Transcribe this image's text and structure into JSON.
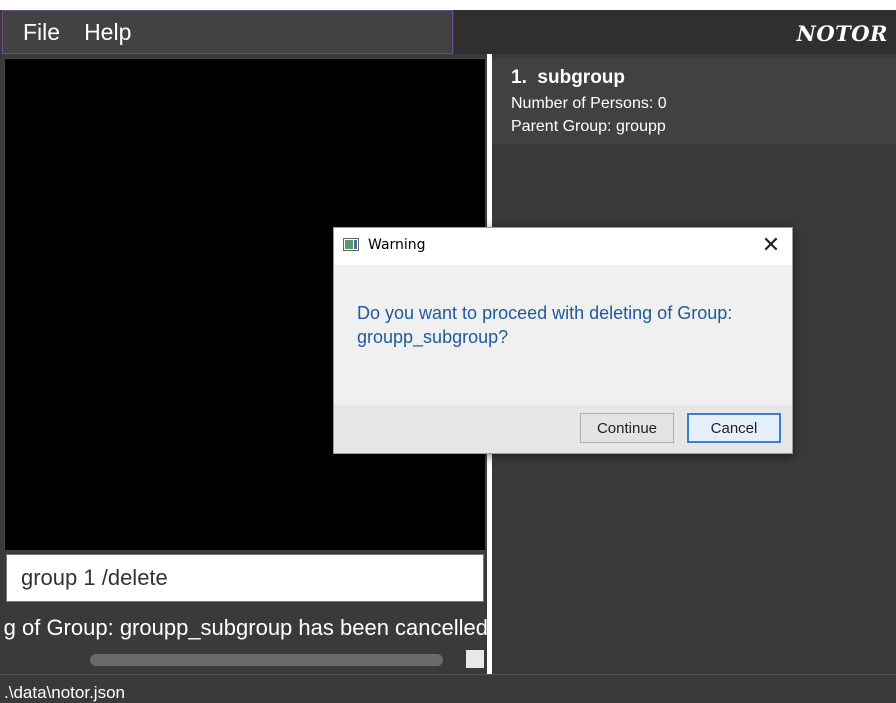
{
  "menu": {
    "items": [
      "File",
      "Help"
    ]
  },
  "app": {
    "logo": "NOTOR"
  },
  "command": {
    "value": "group 1 /delete"
  },
  "result": {
    "text": "Deleting of Group: groupp_subgroup has been cancelled"
  },
  "groups": [
    {
      "index": "1.",
      "name": "subgroup",
      "persons_label": "Number of Persons: 0",
      "parent_label": "Parent Group: groupp"
    }
  ],
  "status": {
    "path": ".\\data\\notor.json"
  },
  "dialog": {
    "title": "Warning",
    "message": "Do you want to proceed with deleting of Group: groupp_subgroup?",
    "buttons": {
      "continue": "Continue",
      "cancel": "Cancel"
    }
  },
  "icons": {
    "close": "close-icon",
    "app": "window-app-icon"
  }
}
